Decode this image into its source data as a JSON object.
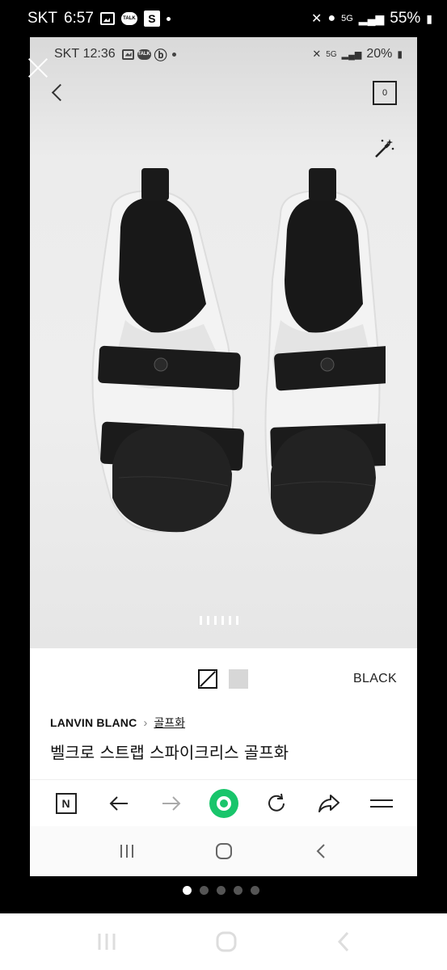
{
  "outer_status": {
    "carrier": "SKT",
    "time": "6:57",
    "network": "5G",
    "battery": "55%"
  },
  "inner_status": {
    "carrier": "SKT",
    "time": "12:36",
    "network": "5G",
    "battery": "20%"
  },
  "header": {
    "cart_count": "0"
  },
  "gallery": {
    "page_indicator_count": 6,
    "icons": [
      "magic-wand-icon"
    ]
  },
  "product": {
    "color_options": [
      "black",
      "light-grey"
    ],
    "selected_color": "BLACK",
    "brand": "LANVIN BLANC",
    "category": "골프화",
    "title": "벨크로 스트랩 스파이크리스 골프화"
  },
  "browser_toolbar": {
    "icons": [
      "naver-n-icon",
      "back-arrow-icon",
      "forward-arrow-icon",
      "green-home-icon",
      "reload-icon",
      "share-icon",
      "menu-icon"
    ]
  },
  "inner_nav": {
    "icons": [
      "recent-apps-icon",
      "home-icon",
      "back-icon"
    ]
  },
  "screenshot_pager": {
    "count": 5,
    "active_index": 0
  },
  "colors": {
    "accent_green": "#19c56b",
    "text_dark": "#111111"
  }
}
